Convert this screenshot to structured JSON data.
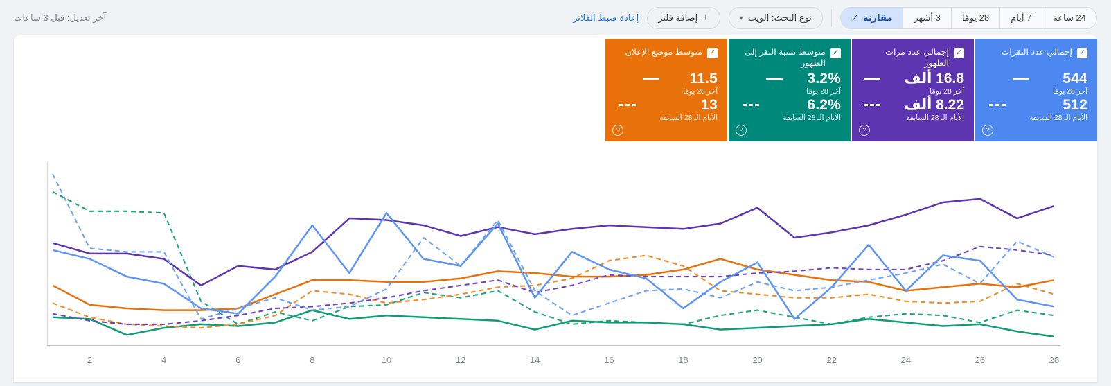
{
  "toolbar": {
    "last_modified": "آخر تعديل: قبل 3 ساعات",
    "reset_filters_label": "إعادة ضبط الفلاتر",
    "add_filter_label": "إضافة فلتر",
    "plus_icon": "+",
    "search_type_label": "نوع البحث: الويب",
    "dropdown_icon": "▾",
    "check_icon": "✓",
    "date_ranges": [
      {
        "label": "24 ساعة",
        "selected": false
      },
      {
        "label": "7 أيام",
        "selected": false
      },
      {
        "label": "28 يومًا",
        "selected": false
      },
      {
        "label": "3 أشهر",
        "selected": false
      },
      {
        "label": "مقارنة",
        "selected": true
      }
    ]
  },
  "cards": [
    {
      "title": "إجمالي عدد النقرات",
      "current_value": "544",
      "current_label": "آخر 28 يومًا",
      "previous_value": "512",
      "previous_label": "الأيام الـ 28 السابقة",
      "color": "#4d88f0",
      "help_icon": "?",
      "checked": true
    },
    {
      "title": "إجمالي عدد مرات الظهور",
      "current_value": "16.8 ألف",
      "current_label": "آخر 28 يومًا",
      "previous_value": "8.22 ألف",
      "previous_label": "الأيام الـ 28 السابقة",
      "color": "#5e35b1",
      "help_icon": "?",
      "checked": true
    },
    {
      "title": "متوسط نسبة النقر إلى الظهور",
      "current_value": "3.2%",
      "current_label": "آخر 28 يومًا",
      "previous_value": "6.2%",
      "previous_label": "الأيام الـ 28 السابقة",
      "color": "#00897b",
      "help_icon": "?",
      "checked": true
    },
    {
      "title": "متوسط موضع الإعلان",
      "current_value": "11.5",
      "current_label": "آخر 28 يومًا",
      "previous_value": "13",
      "previous_label": "الأيام الـ 28 السابقة",
      "color": "#e8710a",
      "help_icon": "?",
      "checked": true
    }
  ],
  "chart_data": {
    "type": "line",
    "x_days": [
      1,
      2,
      3,
      4,
      5,
      6,
      7,
      8,
      9,
      10,
      11,
      12,
      13,
      14,
      15,
      16,
      17,
      18,
      19,
      20,
      21,
      22,
      23,
      24,
      25,
      26,
      27,
      28
    ],
    "x_axis_ticks": [
      2,
      4,
      6,
      8,
      10,
      12,
      14,
      16,
      18,
      20,
      22,
      24,
      26,
      28
    ],
    "ylim": [
      0,
      100
    ],
    "y_unit": "normalized 0-100 (no y-axis labels shown in UI)",
    "grid": "off",
    "legend": "in metric cards (solid = آخر 28 يومًا, dashed = الأيام الـ 28 السابقة)",
    "series": [
      {
        "name": "نسبة النقر إلى الظهور - الأيام الـ 28 السابقة",
        "metric": "ctr",
        "period": "previous",
        "color": "#1fa37a",
        "dashed": true,
        "values": [
          86,
          75,
          75,
          74,
          24,
          11,
          18,
          13,
          21,
          22,
          29,
          26,
          30,
          18,
          11,
          13,
          12,
          11,
          16,
          19,
          15,
          11,
          15,
          17,
          16,
          12,
          19,
          16
        ]
      },
      {
        "name": "نسبة النقر إلى الظهور - آخر 28 يومًا",
        "metric": "ctr",
        "period": "current",
        "color": "#0f9d75",
        "dashed": false,
        "values": [
          15,
          14,
          5,
          9,
          11,
          10,
          12,
          19,
          14,
          16,
          15,
          14,
          13,
          8,
          13,
          12,
          12,
          11,
          8,
          9,
          10,
          11,
          14,
          12,
          10,
          11,
          7,
          4
        ]
      },
      {
        "name": "موضع الإعلان - الأيام الـ 28 السابقة",
        "metric": "position",
        "period": "previous",
        "color": "#ef8c26",
        "dashed": true,
        "values": [
          23,
          15,
          11,
          10,
          9,
          11,
          16,
          30,
          28,
          23,
          25,
          28,
          32,
          33,
          37,
          47,
          50,
          44,
          30,
          28,
          26,
          26,
          28,
          24,
          23,
          24,
          34,
          28
        ]
      },
      {
        "name": "موضع الإعلان - آخر 28 يومًا",
        "metric": "position",
        "period": "current",
        "color": "#e8710a",
        "dashed": false,
        "values": [
          33,
          22,
          20,
          19,
          19,
          20,
          28,
          36,
          36,
          35,
          35,
          37,
          41,
          40,
          38,
          38,
          39,
          42,
          48,
          42,
          39,
          36,
          35,
          30,
          32,
          34,
          32,
          36
        ]
      },
      {
        "name": "مرات الظهور - الأيام الـ 28 السابقة",
        "metric": "impressions",
        "period": "previous",
        "color": "#6e42c1",
        "dashed": true,
        "values": [
          17,
          13,
          11,
          11,
          13,
          16,
          20,
          21,
          23,
          26,
          30,
          33,
          36,
          29,
          33,
          39,
          38,
          38,
          38,
          40,
          41,
          43,
          42,
          42,
          47,
          55,
          53,
          50
        ]
      },
      {
        "name": "مرات الظهور - آخر 28 يومًا",
        "metric": "impressions",
        "period": "current",
        "color": "#5e35b1",
        "dashed": false,
        "values": [
          57,
          51,
          51,
          48,
          33,
          44,
          42,
          52,
          71,
          70,
          67,
          61,
          66,
          62,
          65,
          67,
          66,
          65,
          68,
          77,
          60,
          63,
          67,
          73,
          80,
          82,
          71,
          78
        ]
      },
      {
        "name": "النقرات - الأيام الـ 28 السابقة",
        "metric": "clicks",
        "period": "previous",
        "color": "#6da2f8",
        "dashed": true,
        "values": [
          96,
          54,
          52,
          52,
          14,
          20,
          26,
          19,
          21,
          31,
          60,
          44,
          70,
          30,
          16,
          23,
          30,
          31,
          26,
          35,
          30,
          32,
          36,
          40,
          45,
          34,
          58,
          49
        ]
      },
      {
        "name": "النقرات - آخر 28 يومًا",
        "metric": "clicks",
        "period": "current",
        "color": "#5c95f5",
        "dashed": false,
        "values": [
          53,
          48,
          38,
          34,
          20,
          17,
          38,
          67,
          40,
          74,
          48,
          44,
          68,
          26,
          52,
          42,
          37,
          20,
          35,
          46,
          14,
          32,
          56,
          30,
          50,
          47,
          25,
          21
        ]
      }
    ]
  }
}
